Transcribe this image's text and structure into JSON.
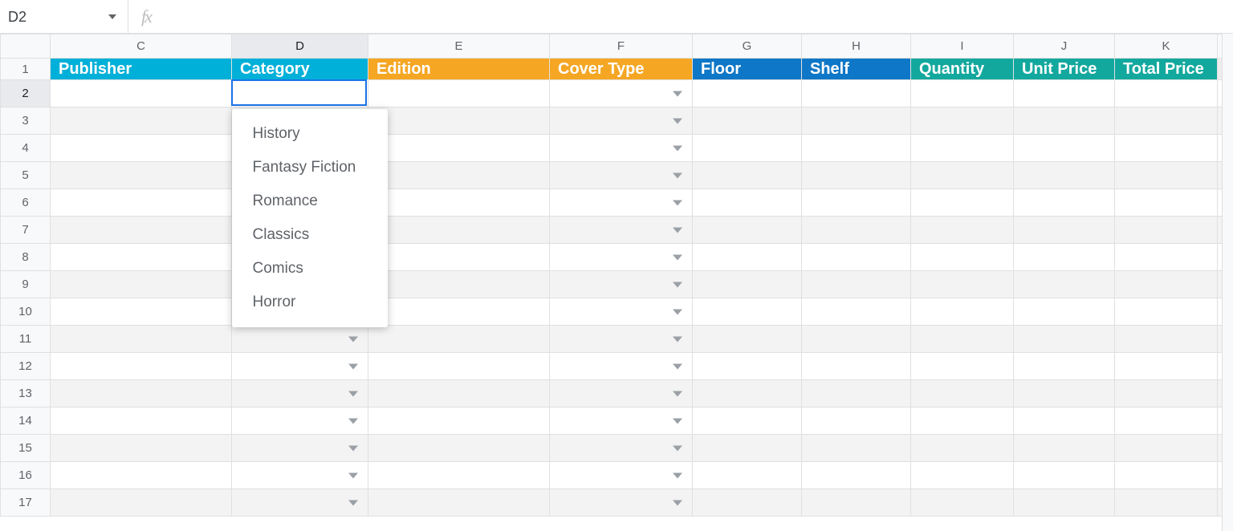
{
  "namebox": {
    "value": "D2"
  },
  "fx": {
    "symbol": "fx",
    "value": ""
  },
  "columnHeaders": {
    "c": "C",
    "d": "D",
    "e": "E",
    "f": "F",
    "g": "G",
    "h": "H",
    "i": "I",
    "j": "J",
    "k": "K"
  },
  "rows": {
    "r1": "1",
    "r2": "2",
    "r3": "3",
    "r4": "4",
    "r5": "5",
    "r6": "6",
    "r7": "7",
    "r8": "8",
    "r9": "9",
    "r10": "10",
    "r11": "11",
    "r12": "12",
    "r13": "13",
    "r14": "14",
    "r15": "15",
    "r16": "16",
    "r17": "17"
  },
  "sheetHeaders": {
    "c": "Publisher",
    "d": "Category",
    "e": "Edition",
    "f": "Cover Type",
    "g": "Floor",
    "h": "Shelf",
    "i": "Quantity",
    "j": "Unit Price",
    "k": "Total Price"
  },
  "activeCell": "D2",
  "columnsWithDropdown": [
    "D",
    "F"
  ],
  "dropdown": {
    "forCell": "D2",
    "options": [
      "History",
      "Fantasy Fiction",
      "Romance",
      "Classics",
      "Comics",
      "Horror"
    ]
  },
  "colors": {
    "cyan": "#00b0d8",
    "orange": "#f5a623",
    "blue": "#0f77c7",
    "teal": "#13a89e",
    "selection": "#1a73e8"
  }
}
